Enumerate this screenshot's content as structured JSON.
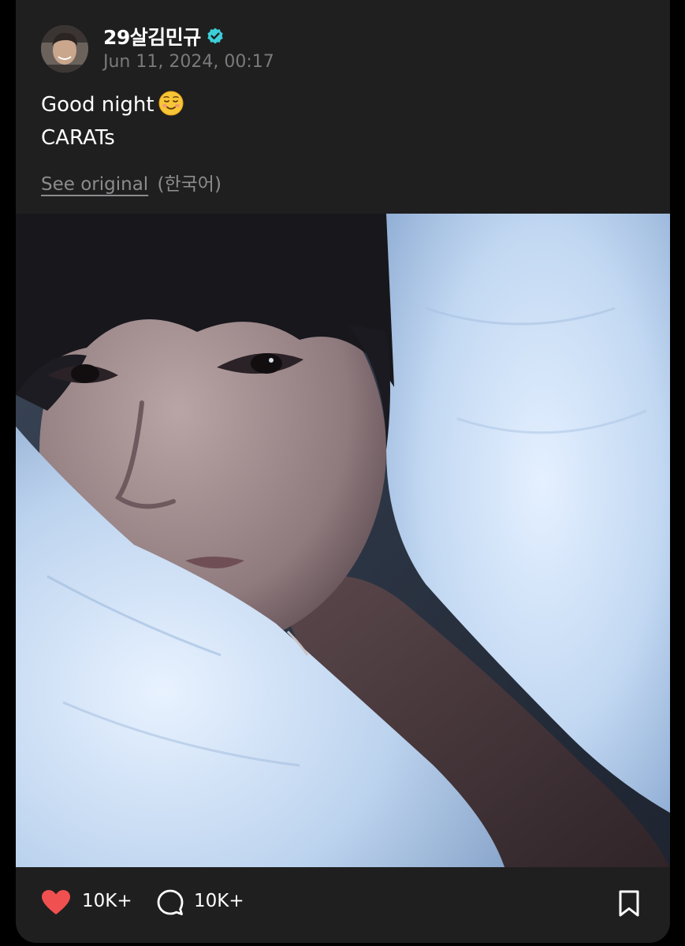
{
  "post": {
    "author": {
      "name": "29살김민규",
      "verified": true,
      "verified_icon": "verified-badge-icon",
      "verified_color": "#3ccfd8"
    },
    "timestamp": "Jun 11, 2024, 00:17",
    "text_lines": [
      "Good night",
      "CARATs"
    ],
    "emoji_icon": "smiling-face-emoji-icon",
    "translation": {
      "link_label": "See original",
      "language_note": "(한국어)"
    }
  },
  "footer": {
    "like_icon": "heart-icon",
    "like_color": "#f0504f",
    "like_count": "10K+",
    "comment_icon": "comment-bubble-icon",
    "comment_count": "10K+",
    "bookmark_icon": "bookmark-icon"
  },
  "theme": {
    "card_background": "#1f1f20",
    "page_background": "#000000",
    "muted_text": "#7a7a7c"
  }
}
